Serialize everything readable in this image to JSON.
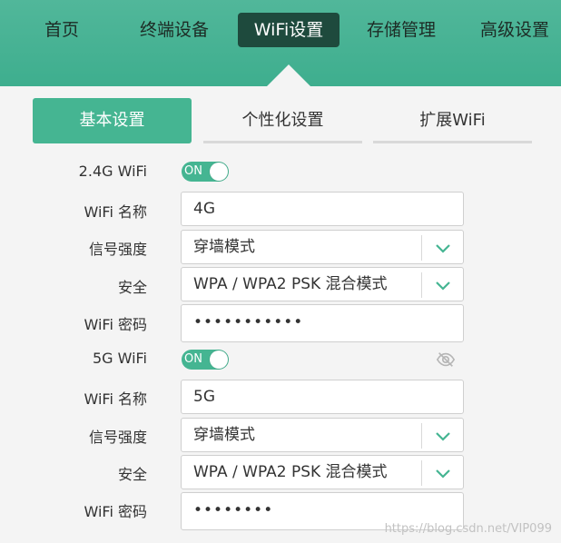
{
  "nav": {
    "items": [
      {
        "label": "首页"
      },
      {
        "label": "终端设备"
      },
      {
        "label": "WiFi设置"
      },
      {
        "label": "存储管理"
      },
      {
        "label": "高级设置"
      }
    ],
    "active_index": 2
  },
  "subtabs": [
    {
      "label": "基本设置",
      "active": true
    },
    {
      "label": "个性化设置",
      "active": false
    },
    {
      "label": "扩展WiFi",
      "active": false
    }
  ],
  "wifi24": {
    "label": "2.4G WiFi",
    "toggle": "ON",
    "name_label": "WiFi 名称",
    "name_value": "4G",
    "signal_label": "信号强度",
    "signal_value": "穿墙模式",
    "security_label": "安全",
    "security_value": "WPA / WPA2 PSK 混合模式",
    "password_label": "WiFi 密码",
    "password_value": "•••••••••••"
  },
  "wifi5": {
    "label": "5G WiFi",
    "toggle": "ON",
    "name_label": "WiFi 名称",
    "name_value": "5G",
    "signal_label": "信号强度",
    "signal_value": "穿墙模式",
    "security_label": "安全",
    "security_value": "WPA / WPA2 PSK 混合模式",
    "password_label": "WiFi 密码",
    "password_value": "••••••••"
  },
  "watermark": "https://blog.csdn.net/VIP099",
  "colors": {
    "accent": "#45b592",
    "nav_active": "#1e4a3d",
    "nav_bg": "#4cb597"
  },
  "icons": {
    "dropdown": "chevron-down-icon",
    "password_visibility": "eye-off-icon"
  }
}
